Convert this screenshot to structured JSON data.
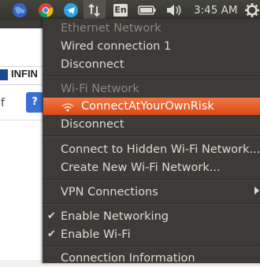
{
  "panel": {
    "clock": "3:45 AM",
    "keyboard_indicator": "En"
  },
  "background_window": {
    "tab_label": "INFIN",
    "input_fragment": "f",
    "button_icon": "?"
  },
  "network_menu": {
    "ethernet_header": "Ethernet Network",
    "wired_connection": "Wired connection 1",
    "ethernet_disconnect": "Disconnect",
    "wifi_header": "Wi-Fi Network",
    "active_network": "ConnectAtYourOwnRisk",
    "wifi_disconnect": "Disconnect",
    "connect_hidden": "Connect to Hidden Wi-Fi Network...",
    "create_new": "Create New Wi-Fi Network...",
    "vpn": "VPN Connections",
    "enable_networking": "Enable Networking",
    "enable_wifi": "Enable Wi-Fi",
    "connection_info": "Connection Information"
  },
  "colors": {
    "menu_bg": "#3c3b37",
    "highlight": "#dd4814",
    "menu_text": "#dfdbd2",
    "header_text": "#8a877f"
  }
}
